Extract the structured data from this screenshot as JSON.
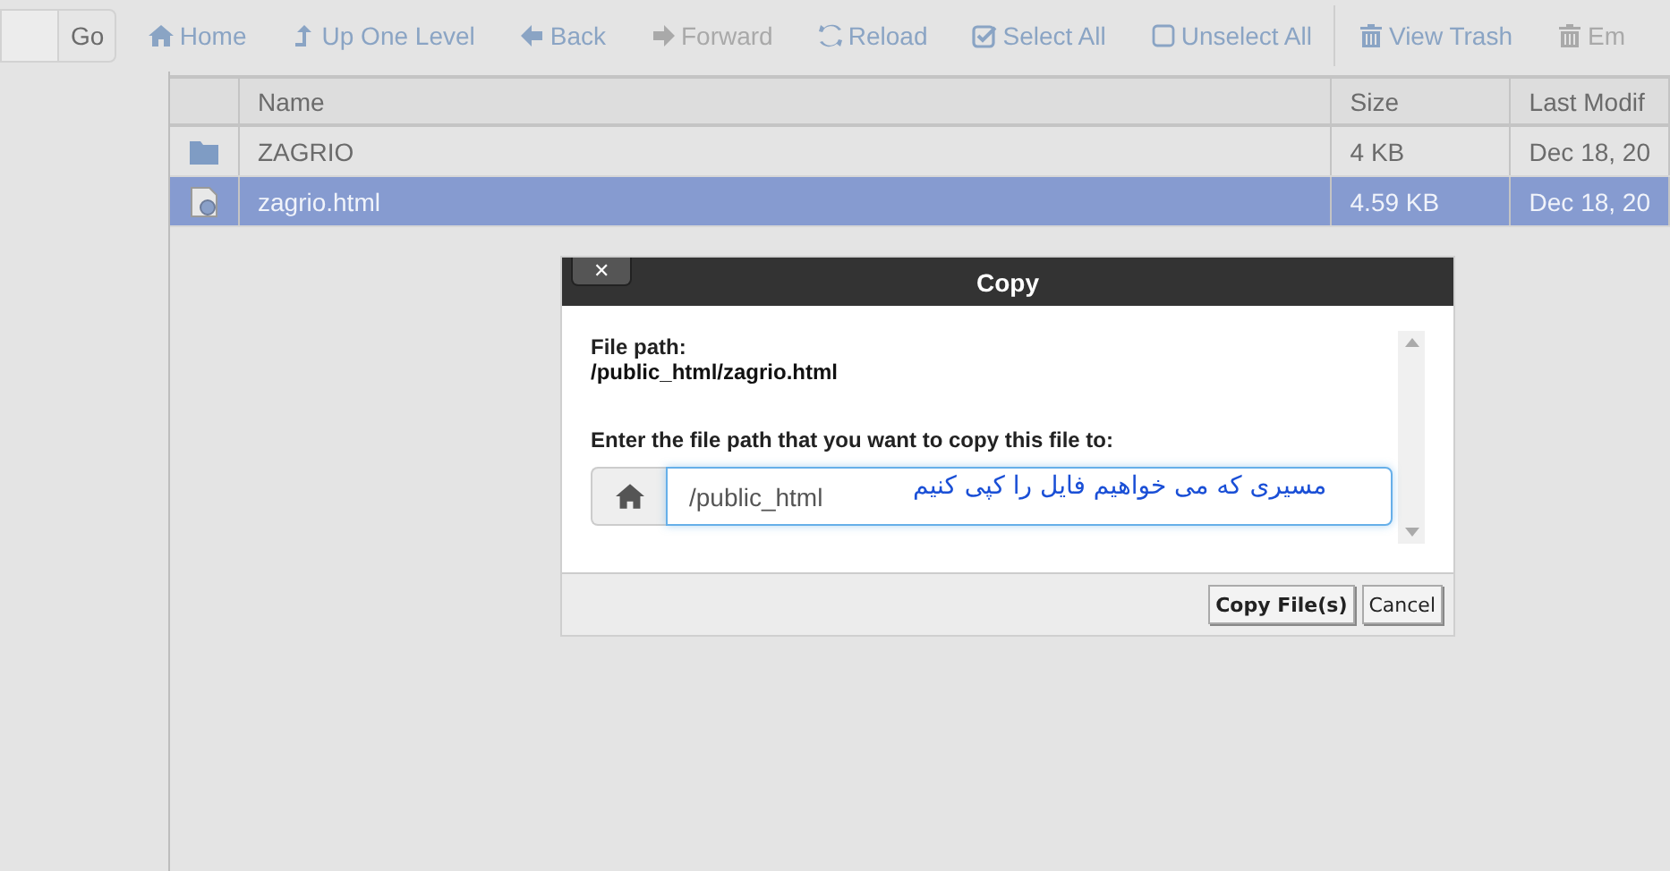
{
  "search": {
    "go_label": "Go"
  },
  "toolbar": [
    {
      "label": "Home",
      "disabled": false
    },
    {
      "label": "Up One Level",
      "disabled": false
    },
    {
      "label": "Back",
      "disabled": false
    },
    {
      "label": "Forward",
      "disabled": true
    },
    {
      "label": "Reload",
      "disabled": false
    },
    {
      "label": "Select All",
      "disabled": false
    },
    {
      "label": "Unselect All",
      "disabled": false
    },
    {
      "label": "View Trash",
      "disabled": false
    },
    {
      "label": "Em",
      "disabled": true
    }
  ],
  "table": {
    "columns": [
      "Name",
      "Size",
      "Last Modif"
    ],
    "rows": [
      {
        "kind": "folder",
        "name": "ZAGRIO",
        "size": "4 KB",
        "modified": "Dec 18, 20",
        "selected": false
      },
      {
        "kind": "file",
        "name": "zagrio.html",
        "size": "4.59 KB",
        "modified": "Dec 18, 20",
        "selected": true
      }
    ]
  },
  "dialog": {
    "title": "Copy",
    "close_label": "✕",
    "path_label": "File path:",
    "path": "/public_html/zagrio.html",
    "prompt": "Enter the file path that you want to copy this file to:",
    "value": "/public_html",
    "annotation": "مسیری که می خواهیم فایل را کپی کنیم",
    "buttons": [
      "Copy File(s)",
      "Cancel"
    ]
  }
}
